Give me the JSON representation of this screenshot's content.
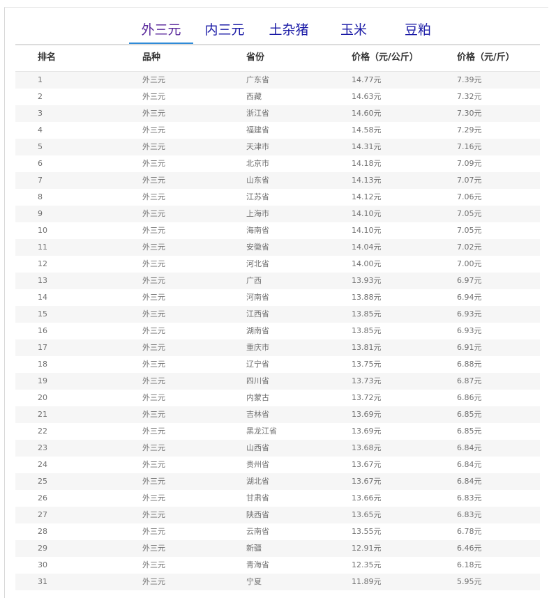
{
  "tabs": [
    "外三元",
    "内三元",
    "土杂猪",
    "玉米",
    "豆粕"
  ],
  "table": {
    "headers": [
      "排名",
      "品种",
      "省份",
      "价格（元/公斤）",
      "价格（元/斤）"
    ],
    "rows": [
      [
        "1",
        "外三元",
        "广东省",
        "14.77元",
        "7.39元"
      ],
      [
        "2",
        "外三元",
        "西藏",
        "14.63元",
        "7.32元"
      ],
      [
        "3",
        "外三元",
        "浙江省",
        "14.60元",
        "7.30元"
      ],
      [
        "4",
        "外三元",
        "福建省",
        "14.58元",
        "7.29元"
      ],
      [
        "5",
        "外三元",
        "天津市",
        "14.31元",
        "7.16元"
      ],
      [
        "6",
        "外三元",
        "北京市",
        "14.18元",
        "7.09元"
      ],
      [
        "7",
        "外三元",
        "山东省",
        "14.13元",
        "7.07元"
      ],
      [
        "8",
        "外三元",
        "江苏省",
        "14.12元",
        "7.06元"
      ],
      [
        "9",
        "外三元",
        "上海市",
        "14.10元",
        "7.05元"
      ],
      [
        "10",
        "外三元",
        "海南省",
        "14.10元",
        "7.05元"
      ],
      [
        "11",
        "外三元",
        "安徽省",
        "14.04元",
        "7.02元"
      ],
      [
        "12",
        "外三元",
        "河北省",
        "14.00元",
        "7.00元"
      ],
      [
        "13",
        "外三元",
        "广西",
        "13.93元",
        "6.97元"
      ],
      [
        "14",
        "外三元",
        "河南省",
        "13.88元",
        "6.94元"
      ],
      [
        "15",
        "外三元",
        "江西省",
        "13.85元",
        "6.93元"
      ],
      [
        "16",
        "外三元",
        "湖南省",
        "13.85元",
        "6.93元"
      ],
      [
        "17",
        "外三元",
        "重庆市",
        "13.81元",
        "6.91元"
      ],
      [
        "18",
        "外三元",
        "辽宁省",
        "13.75元",
        "6.88元"
      ],
      [
        "19",
        "外三元",
        "四川省",
        "13.73元",
        "6.87元"
      ],
      [
        "20",
        "外三元",
        "内蒙古",
        "13.72元",
        "6.86元"
      ],
      [
        "21",
        "外三元",
        "吉林省",
        "13.69元",
        "6.85元"
      ],
      [
        "22",
        "外三元",
        "黑龙江省",
        "13.69元",
        "6.85元"
      ],
      [
        "23",
        "外三元",
        "山西省",
        "13.68元",
        "6.84元"
      ],
      [
        "24",
        "外三元",
        "贵州省",
        "13.67元",
        "6.84元"
      ],
      [
        "25",
        "外三元",
        "湖北省",
        "13.67元",
        "6.84元"
      ],
      [
        "26",
        "外三元",
        "甘肃省",
        "13.66元",
        "6.83元"
      ],
      [
        "27",
        "外三元",
        "陕西省",
        "13.65元",
        "6.83元"
      ],
      [
        "28",
        "外三元",
        "云南省",
        "13.55元",
        "6.78元"
      ],
      [
        "29",
        "外三元",
        "新疆",
        "12.91元",
        "6.46元"
      ],
      [
        "30",
        "外三元",
        "青海省",
        "12.35元",
        "6.18元"
      ],
      [
        "31",
        "外三元",
        "宁夏",
        "11.89元",
        "5.95元"
      ]
    ]
  }
}
